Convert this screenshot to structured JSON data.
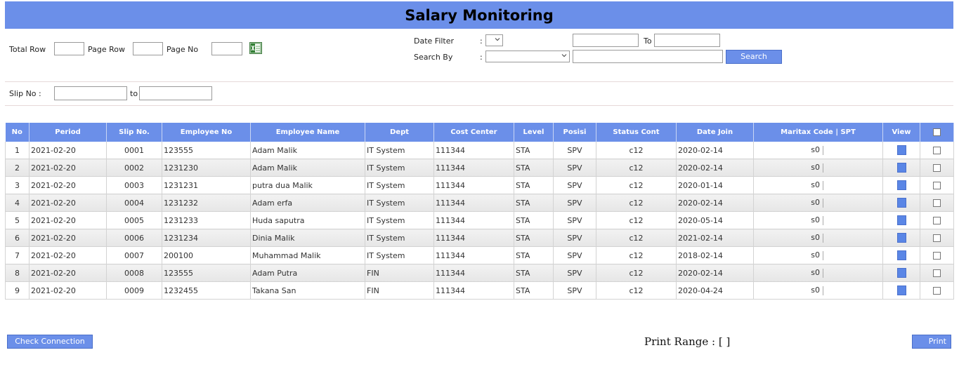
{
  "page": {
    "title": "Salary Monitoring"
  },
  "filters": {
    "total_row_label": "Total Row",
    "page_row_label": "Page Row",
    "page_no_label": "Page No",
    "total_row_value": "",
    "page_row_value": "",
    "page_no_value": "",
    "date_filter_label": "Date Filter",
    "colon": ":",
    "date_filter_selected": "",
    "date_from": "",
    "to_label": "To",
    "date_to": "",
    "search_by_label": "Search By",
    "search_by_selected": "",
    "search_value": "",
    "search_button": "Search",
    "slip_no_label": "Slip No  :",
    "slip_from": "",
    "slip_to_label": "to",
    "slip_to": ""
  },
  "icons": {
    "excel": "excel-export-icon",
    "dropdown": "chevron-down-icon",
    "view": "view-icon"
  },
  "colors": {
    "accent": "#6b8fe9",
    "header_text": "#ffffff"
  },
  "table": {
    "columns": [
      "No",
      "Period",
      "Slip No.",
      "Employee No",
      "Employee Name",
      "Dept",
      "Cost Center",
      "Level",
      "Posisi",
      "Status Cont",
      "Date Join",
      "Maritax Code | SPT",
      "View"
    ],
    "rows": [
      {
        "no": "1",
        "period": "2021-02-20",
        "slip": "0001",
        "emp_no": "123555",
        "name": "Adam Malik",
        "dept": "IT System",
        "cost": "111344",
        "level": "STA",
        "posisi": "SPV",
        "status": "c12",
        "join": "2020-02-14",
        "maritax": "s0"
      },
      {
        "no": "2",
        "period": "2021-02-20",
        "slip": "0002",
        "emp_no": "1231230",
        "name": "Adam Malik",
        "dept": "IT System",
        "cost": "111344",
        "level": "STA",
        "posisi": "SPV",
        "status": "c12",
        "join": "2020-02-14",
        "maritax": "s0"
      },
      {
        "no": "3",
        "period": "2021-02-20",
        "slip": "0003",
        "emp_no": "1231231",
        "name": "putra dua Malik",
        "dept": "IT System",
        "cost": "111344",
        "level": "STA",
        "posisi": "SPV",
        "status": "c12",
        "join": "2020-01-14",
        "maritax": "s0"
      },
      {
        "no": "4",
        "period": "2021-02-20",
        "slip": "0004",
        "emp_no": "1231232",
        "name": "Adam erfa",
        "dept": "IT System",
        "cost": "111344",
        "level": "STA",
        "posisi": "SPV",
        "status": "c12",
        "join": "2020-02-14",
        "maritax": "s0"
      },
      {
        "no": "5",
        "period": "2021-02-20",
        "slip": "0005",
        "emp_no": "1231233",
        "name": "Huda saputra",
        "dept": "IT System",
        "cost": "111344",
        "level": "STA",
        "posisi": "SPV",
        "status": "c12",
        "join": "2020-05-14",
        "maritax": "s0"
      },
      {
        "no": "6",
        "period": "2021-02-20",
        "slip": "0006",
        "emp_no": "1231234",
        "name": "Dinia Malik",
        "dept": "IT System",
        "cost": "111344",
        "level": "STA",
        "posisi": "SPV",
        "status": "c12",
        "join": "2021-02-14",
        "maritax": "s0"
      },
      {
        "no": "7",
        "period": "2021-02-20",
        "slip": "0007",
        "emp_no": "200100",
        "name": "Muhammad Malik",
        "dept": "IT System",
        "cost": "111344",
        "level": "STA",
        "posisi": "SPV",
        "status": "c12",
        "join": "2018-02-14",
        "maritax": "s0"
      },
      {
        "no": "8",
        "period": "2021-02-20",
        "slip": "0008",
        "emp_no": "123555",
        "name": "Adam Putra",
        "dept": "FIN",
        "cost": "111344",
        "level": "STA",
        "posisi": "SPV",
        "status": "c12",
        "join": "2020-02-14",
        "maritax": "s0"
      },
      {
        "no": "9",
        "period": "2021-02-20",
        "slip": "0009",
        "emp_no": "1232455",
        "name": "Takana San",
        "dept": "FIN",
        "cost": "111344",
        "level": "STA",
        "posisi": "SPV",
        "status": "c12",
        "join": "2020-04-24",
        "maritax": "s0"
      }
    ]
  },
  "footer": {
    "check_connection": "Check Connection",
    "print_range": "Print Range : [ ]",
    "print": "Print"
  }
}
